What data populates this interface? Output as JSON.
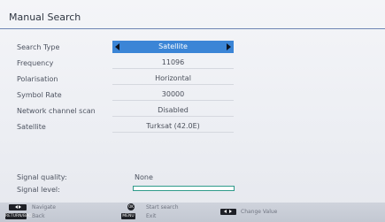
{
  "title": "Manual Search",
  "settings": [
    {
      "label": "Search Type",
      "value": "Satellite",
      "selected": true
    },
    {
      "label": "Frequency",
      "value": "11096"
    },
    {
      "label": "Polarisation",
      "value": "Horizontal"
    },
    {
      "label": "Symbol Rate",
      "value": "30000"
    },
    {
      "label": "Network channel scan",
      "value": "Disabled"
    },
    {
      "label": "Satellite",
      "value": "Turksat (42.0E)"
    }
  ],
  "signal": {
    "quality_label": "Signal quality:",
    "quality_value": "None",
    "level_label": "Signal level:",
    "level_fraction": 0
  },
  "footer": {
    "navigate_label": "Navigate",
    "back_key": "RETURN/BACK",
    "back_label": "Back",
    "ok_key": "OK",
    "start_label": "Start search",
    "menu_key": "MENU",
    "exit_label": "Exit",
    "change_label": "Change Value"
  },
  "colors": {
    "accent": "#3b85d6",
    "signal": "#2f9a8a"
  }
}
